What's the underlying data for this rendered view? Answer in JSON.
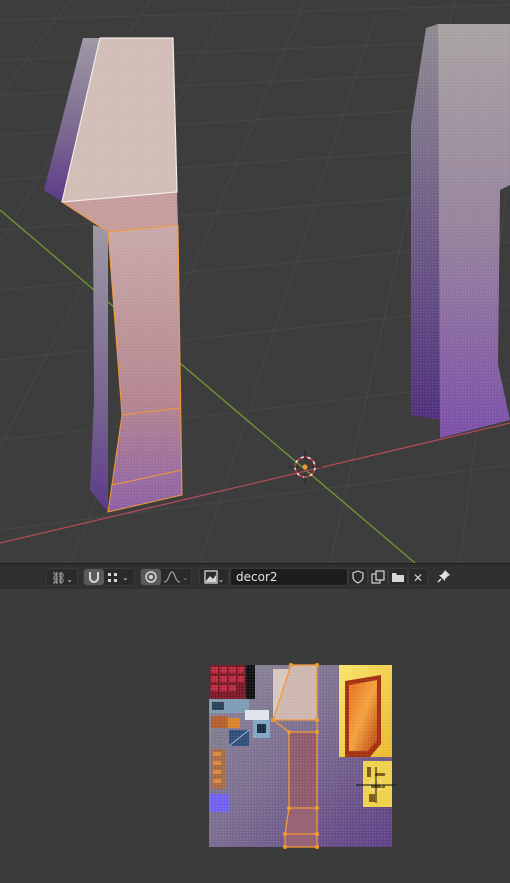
{
  "app": "Blender",
  "viewport": {
    "grid_color": "#474747",
    "background_color": "#3d3d3d",
    "x_axis_color": "#b34b57",
    "y_axis_color": "#6f9b32",
    "selection_color": "#f39a35"
  },
  "uv_toolbar": {
    "pivot_icon": "link-icon",
    "snap_icon": "magnet-icon",
    "snap_target_icon": "vertex-grid-icon",
    "proportional_icon": "proportional-icon",
    "falloff_icon": "falloff-curve-icon",
    "image_browse_icon": "image-icon",
    "image_name": "decor2",
    "fake_user_icon": "shield-icon",
    "new_image_icon": "duplicate-icon",
    "open_image_icon": "folder-icon",
    "unlink_icon": "close-icon",
    "pin_icon": "pin-icon"
  },
  "uv_editor": {
    "background_color": "#3b3b3b",
    "uv_edge_color": "#f39a35"
  }
}
